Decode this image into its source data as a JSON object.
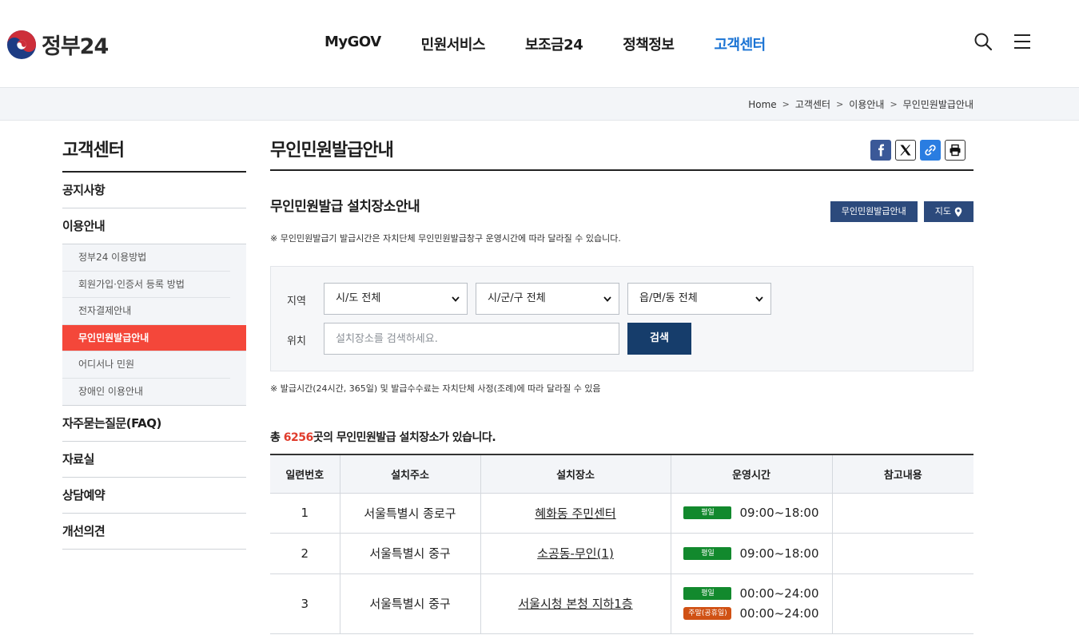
{
  "header": {
    "logo_text": "정부24",
    "nav": [
      "MyGOV",
      "민원서비스",
      "보조금24",
      "정책정보",
      "고객센터"
    ],
    "active_nav": "고객센터",
    "icons": [
      "search-icon",
      "menu-icon"
    ]
  },
  "breadcrumb": [
    "Home",
    "고객센터",
    "이용안내",
    "무인민원발급안내"
  ],
  "sidebar": {
    "title": "고객센터",
    "items": [
      {
        "label": "공지사항"
      },
      {
        "label": "이용안내"
      },
      {
        "label": "자주묻는질문(FAQ)"
      },
      {
        "label": "자료실"
      },
      {
        "label": "상담예약"
      },
      {
        "label": "개선의견"
      }
    ],
    "sub_items": [
      "정부24 이용방법",
      "회원가입·인증서 등록 방법",
      "전자결제안내",
      "무인민원발급안내",
      "어디서나 민원",
      "장애인 이용안내"
    ],
    "active_sub": "무인민원발급안내"
  },
  "main": {
    "title": "무인민원발급안내",
    "share_icons": [
      "facebook-icon",
      "x-icon",
      "link-icon",
      "print-icon"
    ],
    "section_title": "무인민원발급 설치장소안내",
    "btn_guide": "무인민원발급안내",
    "btn_map": "지도",
    "note1": "※ 무인민원발급기 발급시간은 자치단체 무인민원발급창구 운영시간에 따라 달라질 수 있습니다.",
    "search": {
      "label_region": "지역",
      "label_location": "위치",
      "sido": "시/도 전체",
      "sigungu": "시/군/구 전체",
      "eupmyeondong": "읍/면/동 전체",
      "placeholder": "설치장소를 검색하세요.",
      "button": "검색"
    },
    "note2": "※ 발급시간(24시간, 365일) 및 발급수수료는 자치단체 사정(조례)에 따라 달라질 수 있음",
    "total_prefix": "총 ",
    "total_count": "6256",
    "total_suffix": "곳의 무인민원발급 설치장소가 있습니다.",
    "table": {
      "headers": [
        "일련번호",
        "설치주소",
        "설치장소",
        "운영시간",
        "참고내용"
      ],
      "rows": [
        {
          "no": "1",
          "address": "서울특별시 종로구",
          "place": "혜화동 주민센터",
          "hours": [
            {
              "badge": "평일",
              "time": "09:00~18:00"
            }
          ],
          "note": ""
        },
        {
          "no": "2",
          "address": "서울특별시 중구",
          "place": "소공동-무인(1)",
          "hours": [
            {
              "badge": "평일",
              "time": "09:00~18:00"
            }
          ],
          "note": ""
        },
        {
          "no": "3",
          "address": "서울특별시 중구",
          "place": "서울시청 본청 지하1층",
          "hours": [
            {
              "badge": "평일",
              "time": "00:00~24:00"
            },
            {
              "badge": "주말(공휴일)",
              "time": "00:00~24:00"
            }
          ],
          "note": ""
        }
      ]
    }
  },
  "colors": {
    "active_nav": "#1a73d4",
    "active_sub_bg": "#f4473a",
    "navy_button": "#2c4a7c",
    "search_button": "#163d6b",
    "weekday_badge": "#12892d",
    "weekend_badge": "#d05114",
    "total_count": "#e03c2c"
  }
}
